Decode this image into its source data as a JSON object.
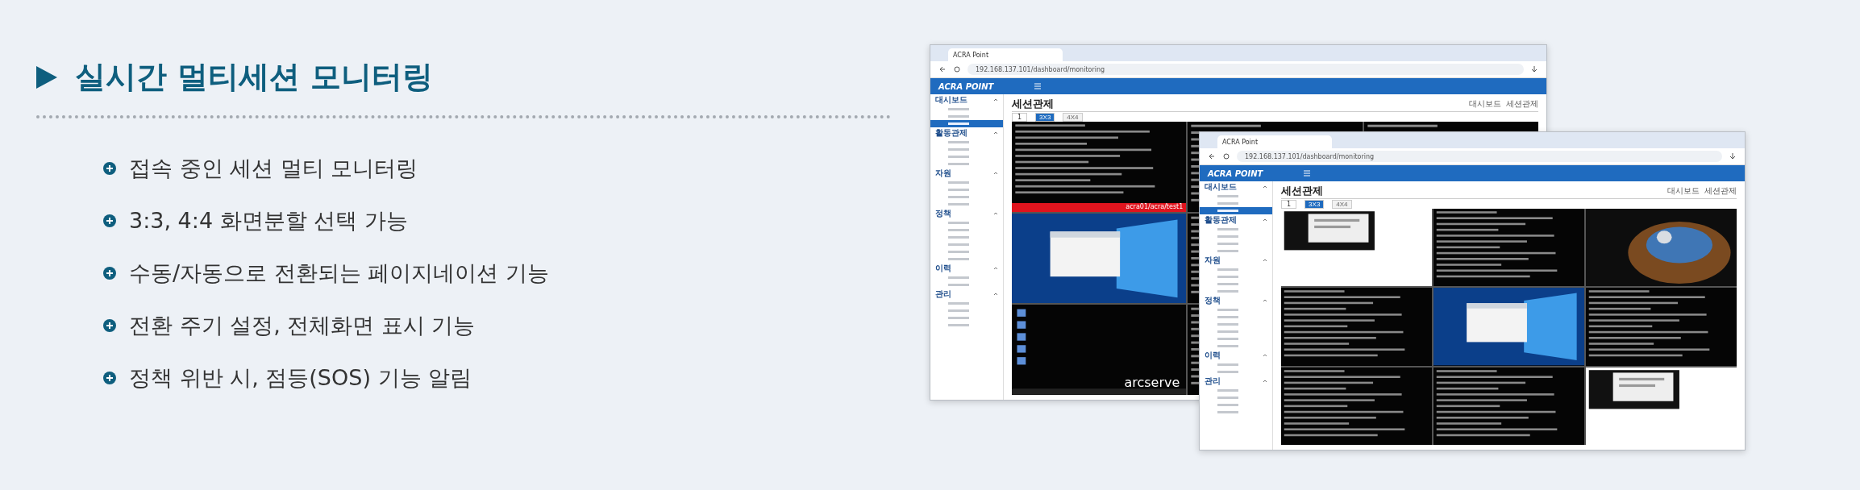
{
  "heading": "실시간 멀티세션 모니터링",
  "features": [
    "접속 중인 세션 멀티 모니터링",
    "3:3, 4:4 화면분할 선택 가능",
    "수동/자동으로 전환되는 페이지네이션 기능",
    "전환 주기 설정, 전체화면 표시 기능",
    "정책 위반 시, 점등(SOS) 기능 알림"
  ],
  "windows": [
    {
      "tab_title": "ACRA Point",
      "url": "192.168.137.101/dashboard/monitoring",
      "logo": "ACRA POINT",
      "page_title": "세션관제",
      "breadcrumb": [
        "대시보드",
        "세션관제"
      ],
      "page": "1",
      "layouts": [
        {
          "label": "3X3",
          "selected": true
        },
        {
          "label": "4X4",
          "selected": false
        }
      ],
      "sections": [
        {
          "label": "대시보드",
          "expanded": true,
          "items": [
            {
              "selected": false
            },
            {
              "selected": false
            },
            {
              "selected": true
            }
          ]
        },
        {
          "label": "활동관제",
          "expanded": true,
          "items": [
            {
              "selected": false
            },
            {
              "selected": false
            },
            {
              "selected": false
            },
            {
              "selected": false
            }
          ]
        },
        {
          "label": "자원",
          "expanded": true,
          "items": [
            {
              "selected": false
            },
            {
              "selected": false
            },
            {
              "selected": false
            },
            {
              "selected": false
            }
          ]
        },
        {
          "label": "정책",
          "expanded": true,
          "items": [
            {
              "selected": false
            },
            {
              "selected": false
            },
            {
              "selected": false
            },
            {
              "selected": false
            },
            {
              "selected": false
            },
            {
              "selected": false
            }
          ]
        },
        {
          "label": "이력",
          "expanded": true,
          "items": [
            {
              "selected": false
            },
            {
              "selected": false
            }
          ]
        },
        {
          "label": "관리",
          "expanded": true,
          "items": [
            {
              "selected": false
            },
            {
              "selected": false
            },
            {
              "selected": false
            },
            {
              "selected": false
            }
          ]
        }
      ],
      "tile_rows": [
        [
          {
            "kind": "terminal",
            "caption": "acra01/acra/test1",
            "alert": true
          },
          {
            "kind": "terminal"
          },
          {
            "kind": "terminal"
          }
        ],
        [
          {
            "kind": "desktop"
          },
          {
            "kind": "terminal"
          }
        ],
        [
          {
            "kind": "icons",
            "brand": "arcserve"
          },
          {
            "kind": "terminal"
          }
        ]
      ]
    },
    {
      "tab_title": "ACRA Point",
      "url": "192.168.137.101/dashboard/monitoring",
      "logo": "ACRA POINT",
      "page_title": "세션관제",
      "breadcrumb": [
        "대시보드",
        "세션관제"
      ],
      "page": "1",
      "layouts": [
        {
          "label": "3X3",
          "selected": true
        },
        {
          "label": "4X4",
          "selected": false
        }
      ],
      "sections": [
        {
          "label": "대시보드",
          "expanded": true,
          "items": [
            {
              "selected": false
            },
            {
              "selected": false
            },
            {
              "selected": true
            }
          ]
        },
        {
          "label": "활동관제",
          "expanded": true,
          "items": [
            {
              "selected": false
            },
            {
              "selected": false
            },
            {
              "selected": false
            },
            {
              "selected": false
            }
          ]
        },
        {
          "label": "자원",
          "expanded": true,
          "items": [
            {
              "selected": false
            },
            {
              "selected": false
            },
            {
              "selected": false
            },
            {
              "selected": false
            }
          ]
        },
        {
          "label": "정책",
          "expanded": true,
          "items": [
            {
              "selected": false
            },
            {
              "selected": false
            },
            {
              "selected": false
            },
            {
              "selected": false
            },
            {
              "selected": false
            },
            {
              "selected": false
            }
          ]
        },
        {
          "label": "이력",
          "expanded": true,
          "items": [
            {
              "selected": false
            },
            {
              "selected": false
            }
          ]
        },
        {
          "label": "관리",
          "expanded": true,
          "items": [
            {
              "selected": false
            },
            {
              "selected": false
            },
            {
              "selected": false
            },
            {
              "selected": false
            }
          ]
        }
      ],
      "tile_rows": [
        [
          {
            "kind": "document"
          },
          {
            "kind": "terminal"
          },
          {
            "kind": "lockscreen"
          }
        ],
        [
          {
            "kind": "terminal"
          },
          {
            "kind": "desktop"
          },
          {
            "kind": "terminal"
          }
        ],
        [
          {
            "kind": "terminal"
          },
          {
            "kind": "terminal"
          },
          {
            "kind": "document"
          }
        ]
      ]
    }
  ]
}
